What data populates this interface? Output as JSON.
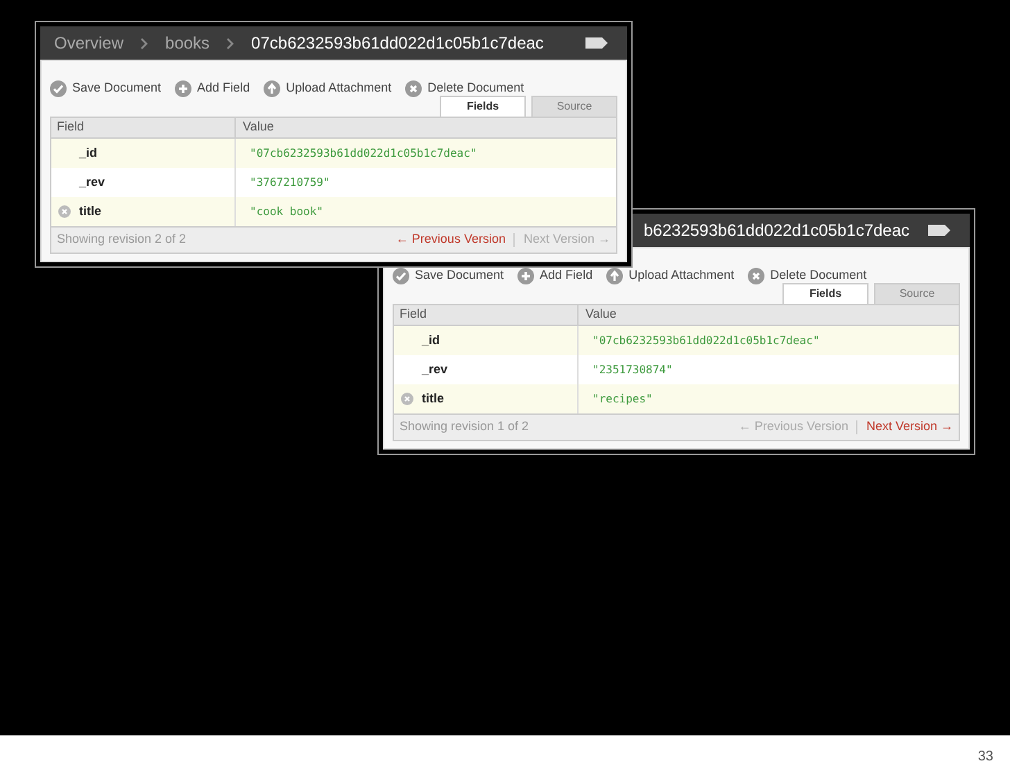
{
  "windows": [
    {
      "breadcrumb": [
        "Overview",
        "books",
        "07cb6232593b61dd022d1c05b1c7deac"
      ],
      "toolbar": [
        {
          "kind": "save",
          "label": "Save Document"
        },
        {
          "kind": "add",
          "label": "Add Field"
        },
        {
          "kind": "upload",
          "label": "Upload Attachment"
        },
        {
          "kind": "delete",
          "label": "Delete Document"
        }
      ],
      "tabs": [
        {
          "label": "Fields",
          "selected": true
        },
        {
          "label": "Source",
          "selected": false
        }
      ],
      "columns": [
        "Field",
        "Value"
      ],
      "rows": [
        {
          "field": "_id",
          "value": "\"07cb6232593b61dd022d1c05b1c7deac\"",
          "deletable": false
        },
        {
          "field": "_rev",
          "value": "\"3767210759\"",
          "deletable": false
        },
        {
          "field": "title",
          "value": "\"cook book\"",
          "deletable": true
        }
      ],
      "status": "Showing revision 2 of 2",
      "previous": {
        "label": "← Previous Version",
        "enabled": true
      },
      "next": {
        "label": "Next Version →",
        "enabled": false
      }
    },
    {
      "breadcrumb": [
        "b6232593b61dd022d1c05b1c7deac"
      ],
      "toolbar": [
        {
          "kind": "save",
          "label": "Save Document"
        },
        {
          "kind": "add",
          "label": "Add Field"
        },
        {
          "kind": "upload",
          "label": "Upload Attachment"
        },
        {
          "kind": "delete",
          "label": "Delete Document"
        }
      ],
      "tabs": [
        {
          "label": "Fields",
          "selected": true
        },
        {
          "label": "Source",
          "selected": false
        }
      ],
      "columns": [
        "Field",
        "Value"
      ],
      "rows": [
        {
          "field": "_id",
          "value": "\"07cb6232593b61dd022d1c05b1c7deac\"",
          "deletable": false
        },
        {
          "field": "_rev",
          "value": "\"2351730874\"",
          "deletable": false
        },
        {
          "field": "title",
          "value": "\"recipes\"",
          "deletable": true
        }
      ],
      "status": "Showing revision 1 of 2",
      "previous": {
        "label": "← Previous Version",
        "enabled": false
      },
      "next": {
        "label": "Next Version →",
        "enabled": true
      }
    }
  ],
  "page_number": "33"
}
